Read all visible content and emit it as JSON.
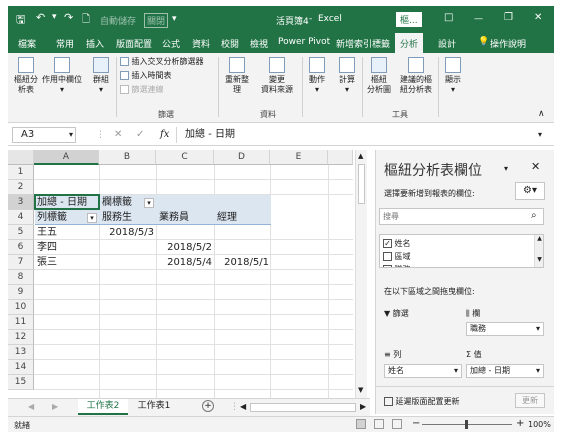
{
  "titlebar": {
    "qat_save_icon": "save-icon",
    "autosave_label": "自動儲存",
    "autosave_state": "關閉",
    "filename": "活頁簿4",
    "app": "Excel",
    "tools_label": "樞...",
    "restore_label": "□",
    "minimize_label": "—",
    "close_label": "✕"
  },
  "ribbon_tabs": [
    "檔案",
    "常用",
    "插入",
    "版面配置",
    "公式",
    "資料",
    "校閱",
    "檢視",
    "Power Pivot",
    "新增索引標籤",
    "分析",
    "設計"
  ],
  "tell_me": "操作說明",
  "ribbon": {
    "pivot_table_label": "樞紐分\n析表",
    "active_field_label": "作用中欄位",
    "group_label": "群組",
    "insert_slicer": "插入交叉分析篩選器",
    "insert_timeline": "插入時間表",
    "filter_connections": "篩選連線",
    "filter_group": "篩選",
    "refresh_label": "重新整\n理",
    "change_source_label": "變更\n資料來源",
    "data_group": "資料",
    "actions_label": "動作",
    "calculations_label": "計算",
    "pivot_chart_label": "樞紐\n分析圖",
    "recommended_label": "建議的樞\n紐分析表",
    "tools_group": "工具",
    "show_label": "顯示"
  },
  "formula": {
    "name_box": "A3",
    "fx": "fx",
    "content": "加總 - 日期"
  },
  "grid": {
    "columns": [
      "A",
      "B",
      "C",
      "D",
      "E"
    ],
    "rows": [
      "1",
      "2",
      "3",
      "4",
      "5",
      "6",
      "7",
      "8",
      "9",
      "10",
      "11",
      "12",
      "13",
      "14",
      "15"
    ],
    "a3": "加總 - 日期",
    "b3": "欄標籤",
    "a4": "列標籤",
    "b4": "服務生",
    "c4": "業務員",
    "d4": "經理",
    "a5": "王五",
    "b5": "2018/5/3",
    "a6": "李四",
    "c6": "2018/5/2",
    "a7": "張三",
    "c7": "2018/5/4",
    "d7": "2018/5/1"
  },
  "panel": {
    "title": "樞紐分析表欄位",
    "subtitle": "選擇要新增到報表的欄位:",
    "search_placeholder": "搜尋",
    "fields": [
      {
        "label": "姓名",
        "checked": true
      },
      {
        "label": "區域",
        "checked": false
      },
      {
        "label": "職務",
        "checked": false
      }
    ],
    "drag_hint": "在以下區域之間拖曳欄位:",
    "filters_label": "篩選",
    "columns_label": "欄",
    "rows_label": "列",
    "values_label": "值",
    "columns_value": "職務",
    "rows_value": "姓名",
    "values_value": "加總 - 日期",
    "defer_label": "延遲版面配置更新",
    "update_label": "更新"
  },
  "sheets": [
    "工作表2",
    "工作表1"
  ],
  "active_sheet": "工作表2",
  "status": {
    "ready": "就緒",
    "zoom": "100%",
    "minus": "−",
    "plus": "+"
  },
  "colors": {
    "excel_green": "#217346",
    "pivot_header_blue": "#dce6f1"
  }
}
